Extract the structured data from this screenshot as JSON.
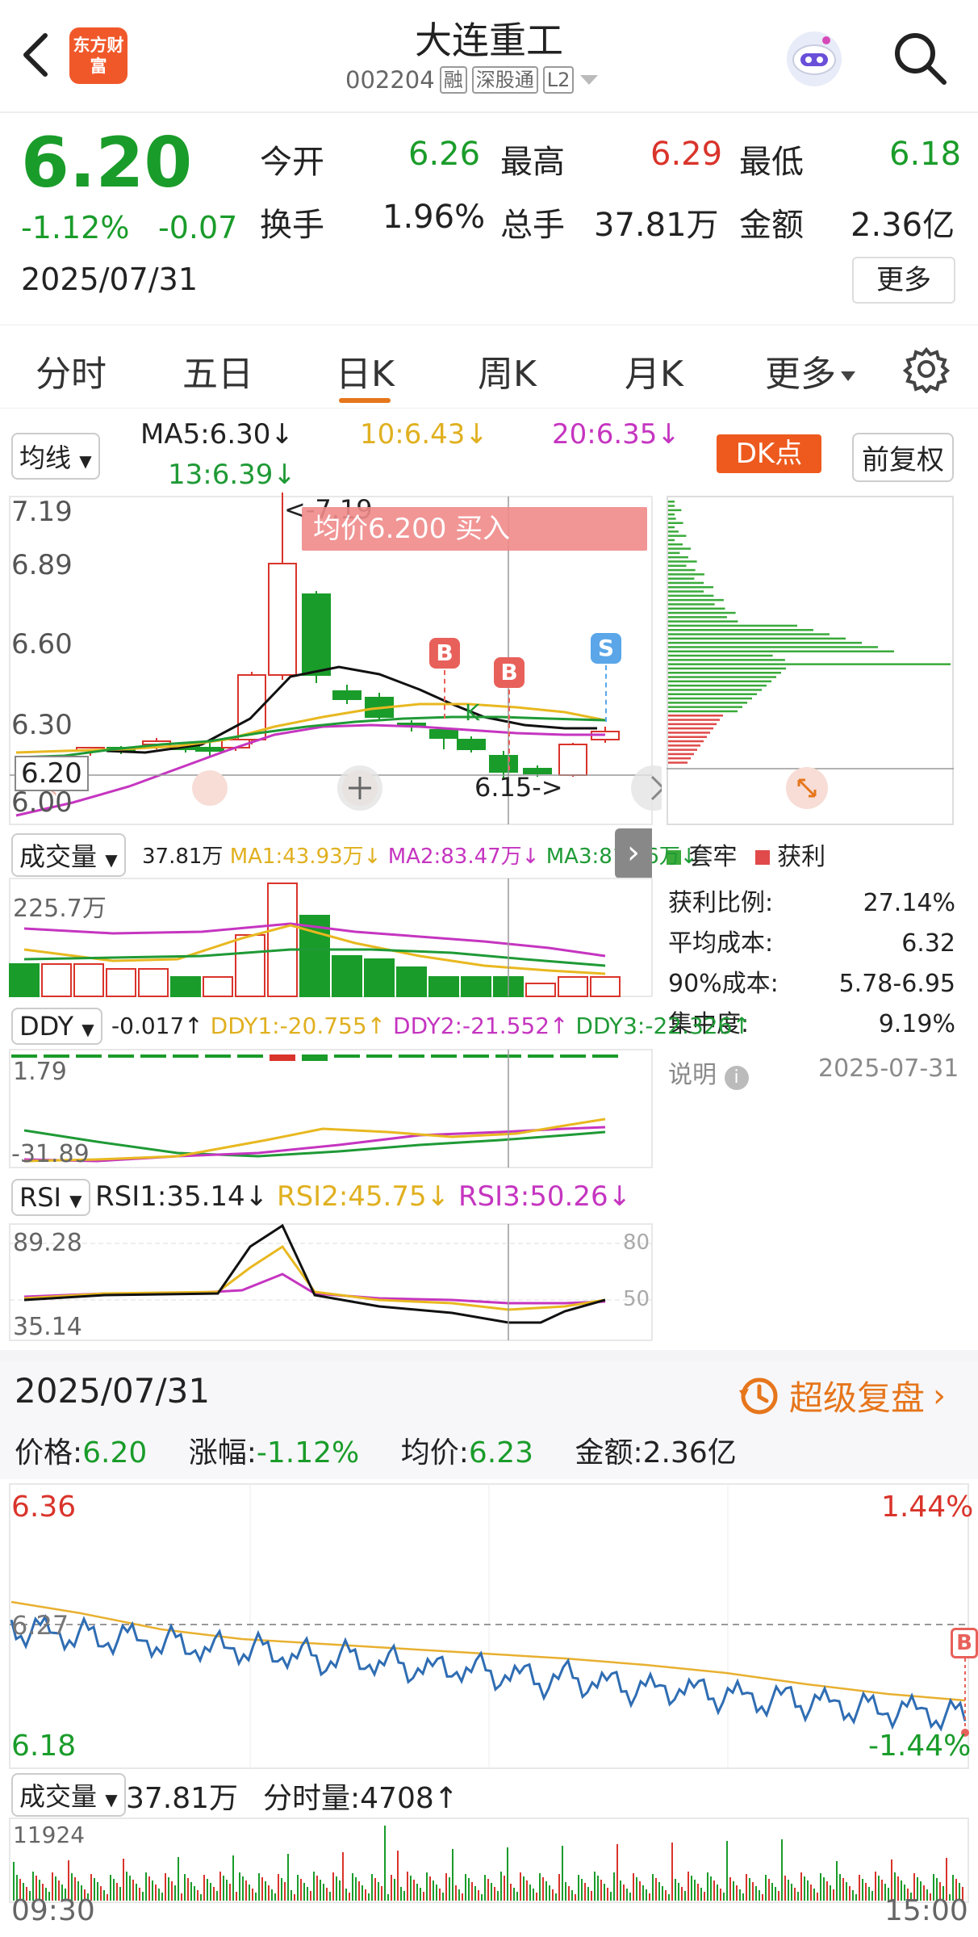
{
  "header": {
    "title": "大连重工",
    "code": "002204",
    "tag_rong": "融",
    "tag_sgt": "深股通",
    "tag_l2": "L2",
    "logo_text": "东方财富"
  },
  "quote": {
    "price": "6.20",
    "change_pct": "-1.12%",
    "change": "-0.07",
    "date": "2025/07/31",
    "open_label": "今开",
    "open": "6.26",
    "high_label": "最高",
    "high": "6.29",
    "low_label": "最低",
    "low": "6.18",
    "turnover_label": "换手",
    "turnover": "1.96%",
    "volume_label": "总手",
    "volume": "37.81万",
    "amount_label": "金额",
    "amount": "2.36亿",
    "more": "更多"
  },
  "tabs": [
    "分时",
    "五日",
    "日K",
    "周K",
    "月K",
    "更多"
  ],
  "active_tab": 2,
  "kline": {
    "ma_selector": "均线",
    "ma5": "MA5:6.30↓",
    "ma10": "10:6.43↓",
    "ma20": "20:6.35↓",
    "ma13": "13:6.39↓",
    "dk_button": "DK点",
    "adjust": "前复权",
    "y_labels": [
      "7.19",
      "6.89",
      "6.60",
      "6.30",
      "6.00"
    ],
    "cursor_price": "6.20",
    "high_mark": "<-7.19",
    "low_mark": "6.15->",
    "tooltip": "均价6.200  买入",
    "mark_b": "B",
    "mark_s": "S",
    "mark_k": "K"
  },
  "chips": {
    "legend_trapped": "套牢",
    "legend_profit": "获利",
    "rows": [
      {
        "label": "获利比例:",
        "value": "27.14%"
      },
      {
        "label": "平均成本:",
        "value": "6.32"
      },
      {
        "label": "90%成本:",
        "value": "5.78-6.95"
      },
      {
        "label": "集中度:",
        "value": "9.19%"
      }
    ],
    "note": "说明",
    "date": "2025-07-31"
  },
  "volume_panel": {
    "selector": "成交量",
    "v": "37.81万",
    "ma1": "MA1:43.93万↓",
    "ma2": "MA2:83.47万↓",
    "ma3": "MA3:81.56万↓",
    "max_label": "225.7万"
  },
  "ddy_panel": {
    "selector": "DDY",
    "v": "-0.017↑",
    "ddy1": "DDY1:-20.755↑",
    "ddy2": "DDY2:-21.552↑",
    "ddy3": "DDY3:-22.326↑",
    "top": "1.79",
    "bottom": "-31.89"
  },
  "rsi_panel": {
    "selector": "RSI",
    "rsi1": "RSI1:35.14↓",
    "rsi2": "RSI2:45.75↓",
    "rsi3": "RSI3:50.26↓",
    "top": "89.28",
    "bottom": "35.14",
    "l80": "80",
    "l50": "50"
  },
  "replay": {
    "date": "2025/07/31",
    "button": "超级复盘",
    "price_label": "价格:",
    "price": "6.20",
    "chg_label": "涨幅:",
    "chg": "-1.12%",
    "avg_label": "均价:",
    "avg": "6.23",
    "amt_label": "金额:",
    "amt": "2.36亿"
  },
  "intraday": {
    "top_left": "6.36",
    "top_right": "1.44%",
    "mid": "6.27",
    "bottom_left": "6.18",
    "bottom_right": "-1.44%",
    "mark_b": "B",
    "vol_selector": "成交量",
    "vol": "37.81万",
    "fsl_label": "分时量:",
    "fsl": "4708↑",
    "vol_max": "11924",
    "t_start": "09:30",
    "t_end": "15:00"
  },
  "colors": {
    "up": "#d9342b",
    "down": "#1a9c2a",
    "accent": "#e6761c",
    "ma5": "#111111",
    "ma10": "#e8b820",
    "ma20": "#c535c0",
    "ma13": "#1f9a36",
    "price_line": "#2f6db3",
    "avg_line": "#e8b030"
  }
}
